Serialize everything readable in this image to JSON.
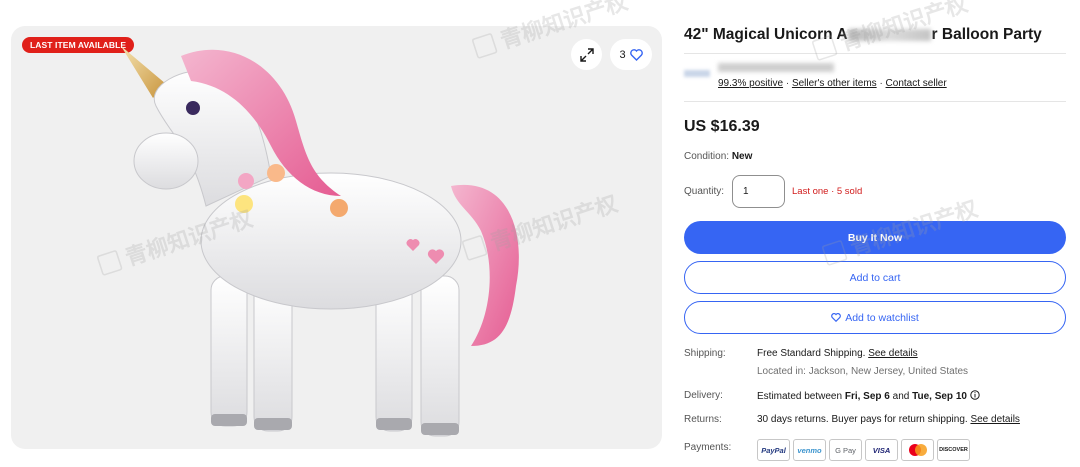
{
  "gallery": {
    "badge": "LAST ITEM AVAILABLE",
    "watch_count": "3",
    "image_alt": "Pink and white unicorn foil balloon"
  },
  "listing": {
    "title_start": "42\" Magical Unicorn A",
    "title_end": "r Balloon Party",
    "seller_feedback": "99.3% positive",
    "seller_other_items": "Seller's other items",
    "contact_seller": "Contact seller",
    "price": "US $16.39",
    "condition_label": "Condition:",
    "condition_value": "New",
    "quantity_label": "Quantity:",
    "quantity_value": "1",
    "quantity_note": "Last one · 5 sold"
  },
  "actions": {
    "buy_now": "Buy It Now",
    "add_to_cart": "Add to cart",
    "add_to_watchlist": "Add to watchlist"
  },
  "shipping": {
    "label": "Shipping:",
    "value": "Free Standard Shipping.",
    "details_link": "See details",
    "location": "Located in: Jackson, New Jersey, United States"
  },
  "delivery": {
    "label": "Delivery:",
    "value_prefix": "Estimated between",
    "start": "Fri, Sep 6",
    "and": "and",
    "end": "Tue, Sep 10"
  },
  "returns": {
    "label": "Returns:",
    "value": "30 days returns. Buyer pays for return shipping.",
    "details_link": "See details"
  },
  "payments": {
    "label": "Payments:",
    "methods": [
      "PayPal",
      "venmo",
      "G Pay",
      "VISA",
      "mastercard",
      "DISCOVER"
    ]
  },
  "colors": {
    "accent_blue": "#3665f3",
    "badge_red": "#e0201a",
    "urgent_red": "#d11b1b"
  }
}
